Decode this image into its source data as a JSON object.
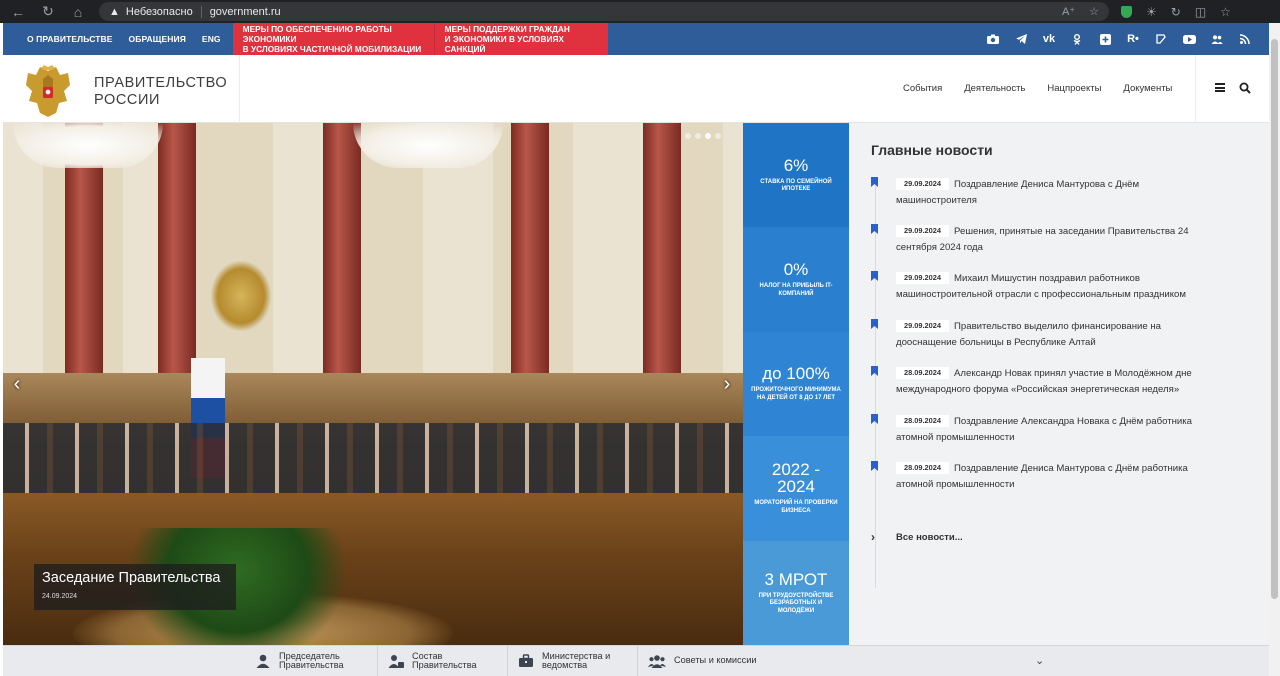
{
  "browser": {
    "security_label": "Небезопасно",
    "url": "government.ru"
  },
  "topbar": {
    "links": [
      "О ПРАВИТЕЛЬСТВЕ",
      "ОБРАЩЕНИЯ",
      "ENG"
    ],
    "promo1_line1": "МЕРЫ ПО ОБЕСПЕЧЕНИЮ РАБОТЫ ЭКОНОМИКИ",
    "promo1_line2": "В УСЛОВИЯХ ЧАСТИЧНОЙ МОБИЛИЗАЦИИ",
    "promo2_line1": "МЕРЫ ПОДДЕРЖКИ ГРАЖДАН",
    "promo2_line2": "И ЭКОНОМИКИ В УСЛОВИЯХ САНКЦИЙ",
    "socials": [
      "camera-icon",
      "telegram-icon",
      "vk-icon",
      "ok-icon",
      "plus-icon",
      "rutube-icon",
      "dzen-icon",
      "youtube-icon",
      "people-icon",
      "rss-icon"
    ]
  },
  "header": {
    "title_line1": "ПРАВИТЕЛЬСТВО",
    "title_line2": "РОССИИ",
    "nav": [
      "События",
      "Деятельность",
      "Нацпроекты",
      "Документы"
    ]
  },
  "hero": {
    "caption_title": "Заседание Правительства",
    "caption_date": "24.09.2024",
    "slides_total": 4,
    "slide_active": 3
  },
  "tiles": [
    {
      "big": "6%",
      "small": "СТАВКА ПО СЕМЕЙНОЙ ИПОТЕКЕ"
    },
    {
      "big": "0%",
      "small": "НАЛОГ НА ПРИБЫЛЬ IT-КОМПАНИЙ"
    },
    {
      "big": "до 100%",
      "small": "ПРОЖИТОЧНОГО МИНИМУМА НА ДЕТЕЙ ОТ 8 ДО 17 ЛЕТ"
    },
    {
      "big": "2022 - 2024",
      "small": "МОРАТОРИЙ НА ПРОВЕРКИ БИЗНЕСА"
    },
    {
      "big": "3 МРОТ",
      "small": "ПРИ ТРУДОУСТРОЙСТВЕ БЕЗРАБОТНЫХ И МОЛОДЁЖИ"
    }
  ],
  "news": {
    "heading": "Главные новости",
    "items": [
      {
        "date": "29.09.2024",
        "text": "Поздравление Дениса Мантурова с Днём машиностроителя"
      },
      {
        "date": "29.09.2024",
        "text": "Решения, принятые на заседании Правительства 24 сентября 2024 года"
      },
      {
        "date": "29.09.2024",
        "text": "Михаил Мишустин поздравил работников машиностроительной отрасли с профессиональным праздником"
      },
      {
        "date": "29.09.2024",
        "text": "Правительство выделило финансирование на дооснащение больницы в Республике Алтай"
      },
      {
        "date": "28.09.2024",
        "text": "Александр Новак принял участие в Молодёжном дне международного форума «Российская энергетическая неделя»"
      },
      {
        "date": "28.09.2024",
        "text": "Поздравление Александра Новака с Днём работника атомной промышленности"
      },
      {
        "date": "28.09.2024",
        "text": "Поздравление Дениса Мантурова с Днём работника атомной промышленности"
      }
    ],
    "all_news": "Все новости..."
  },
  "bottombar": {
    "items": [
      {
        "line1": "Председатель",
        "line2": "Правительства",
        "icon": "person-icon"
      },
      {
        "line1": "Состав",
        "line2": "Правительства",
        "icon": "group-lock-icon"
      },
      {
        "line1": "Министерства и",
        "line2": "ведомства",
        "icon": "briefcase-icon"
      },
      {
        "line1": "Советы и комиссии",
        "line2": "",
        "icon": "team-icon"
      }
    ]
  },
  "colors": {
    "topbar": "#2f5d9a",
    "promo": "#e0313e",
    "tile_blue": "#1f74c5",
    "news_bg": "#f1f2f4",
    "bookmark": "#2a5fd0"
  }
}
